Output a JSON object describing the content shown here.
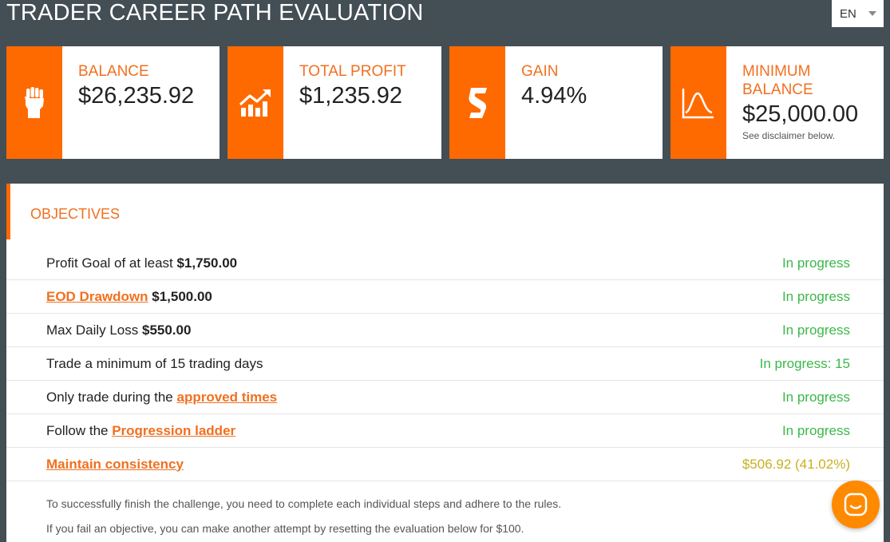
{
  "header": {
    "title": "TRADER CAREER PATH EVALUATION",
    "language": "EN"
  },
  "stats": [
    {
      "label": "BALANCE",
      "value": "$26,235.92",
      "icon": "raised-fist-icon"
    },
    {
      "label": "TOTAL PROFIT",
      "value": "$1,235.92",
      "icon": "trending-up-bars-icon"
    },
    {
      "label": "GAIN",
      "value": "4.94%",
      "icon": "dollar-s-icon"
    },
    {
      "label": "MINIMUM BALANCE",
      "value": "$25,000.00",
      "note": "See disclaimer below.",
      "icon": "curve-chart-icon"
    }
  ],
  "objectives": {
    "heading": "OBJECTIVES",
    "rows": [
      {
        "text": "Profit Goal of at least ",
        "bold": "$1,750.00",
        "status": "In progress"
      },
      {
        "link": "EOD Drawdown",
        "bold": "$1,500.00",
        "status": "In progress"
      },
      {
        "text": "Max Daily Loss ",
        "bold": "$550.00",
        "status": "In progress"
      },
      {
        "text": "Trade a minimum of 15 trading days",
        "status": "In progress: 15"
      },
      {
        "text": "Only trade during the ",
        "link": "approved times",
        "status": "In progress"
      },
      {
        "text": "Follow the ",
        "link": "Progression ladder",
        "status": "In progress"
      },
      {
        "link": "Maintain consistency",
        "status": "$506.92 (41.02%)"
      }
    ],
    "footnotes": [
      "To successfully finish the challenge, you need to complete each individual steps and adhere to the rules.",
      "If you fail an objective, you can make another attempt by resetting the evaluation below for $100."
    ]
  },
  "colors": {
    "accent": "#ff6a00",
    "background": "#434e55",
    "status_ok": "#3cb84a",
    "status_warn": "#c9b020"
  }
}
